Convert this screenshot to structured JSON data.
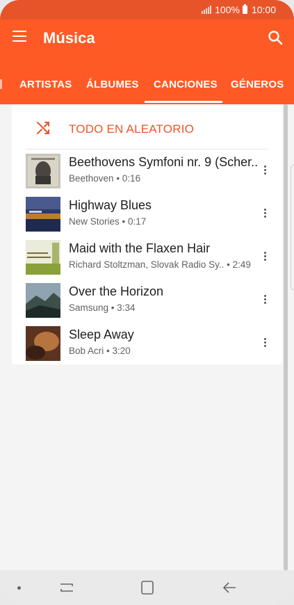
{
  "status_bar": {
    "battery": "100%",
    "time": "10:00"
  },
  "app_bar": {
    "title": "Música",
    "menu_icon": "hamburger-menu-icon",
    "search_icon": "search-icon"
  },
  "tabs": [
    {
      "label": "ARTISTAS",
      "selected": false
    },
    {
      "label": "ÁLBUMES",
      "selected": false
    },
    {
      "label": "CANCIONES",
      "selected": true
    },
    {
      "label": "GÉNEROS",
      "selected": false
    }
  ],
  "shuffle": {
    "label": "TODO EN ALEATORIO",
    "icon": "shuffle-icon"
  },
  "songs": [
    {
      "title": "Beethovens Symfoni nr. 9 (Scher..",
      "artist": "Beethoven",
      "duration": "0:16"
    },
    {
      "title": "Highway Blues",
      "artist": "New Stories",
      "duration": "0:17"
    },
    {
      "title": "Maid with the Flaxen Hair",
      "artist": "Richard Stoltzman, Slovak Radio Sy..",
      "duration": "2:49"
    },
    {
      "title": "Over the Horizon",
      "artist": "Samsung",
      "duration": "3:34"
    },
    {
      "title": "Sleep Away",
      "artist": "Bob Acri",
      "duration": "3:20"
    }
  ],
  "colors": {
    "accent": "#fe5a25",
    "status_bar": "#e8542a",
    "shuffle_text": "#e8562a"
  },
  "nav_bar": {
    "icons": [
      "nav-dot-icon",
      "recent-apps-icon",
      "home-icon",
      "back-icon"
    ]
  }
}
